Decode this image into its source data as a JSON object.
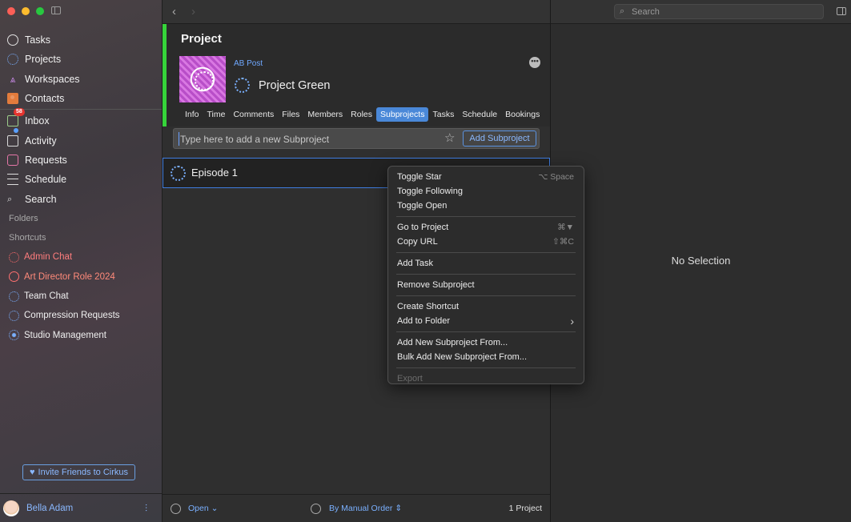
{
  "sidebar": {
    "nav": [
      {
        "label": "Tasks",
        "icon": "circle-icon"
      },
      {
        "label": "Projects",
        "icon": "dotted-circle-icon"
      },
      {
        "label": "Workspaces",
        "icon": "workspaces-icon"
      },
      {
        "label": "Contacts",
        "icon": "contacts-icon"
      }
    ],
    "nav2": [
      {
        "label": "Inbox",
        "icon": "inbox-icon",
        "badge": "58"
      },
      {
        "label": "Activity",
        "icon": "activity-icon"
      },
      {
        "label": "Requests",
        "icon": "requests-icon"
      },
      {
        "label": "Schedule",
        "icon": "schedule-icon"
      },
      {
        "label": "Search",
        "icon": "search-icon"
      }
    ],
    "folders_label": "Folders",
    "shortcuts_label": "Shortcuts",
    "shortcuts": [
      {
        "label": "Admin Chat",
        "color": "#ff7d7d"
      },
      {
        "label": "Art Director Role 2024",
        "color": "#ff8a7a"
      },
      {
        "label": "Team Chat",
        "color": "#f0f0f0"
      },
      {
        "label": "Compression Requests",
        "color": "#f0f0f0"
      },
      {
        "label": "Studio Management",
        "color": "#f0f0f0"
      }
    ],
    "invite_label": "Invite Friends to Cirkus",
    "user_name": "Bella Adam"
  },
  "project": {
    "header_title": "Project",
    "workspace": "AB Post",
    "name": "Project Green",
    "more_label": "•••",
    "tabs": [
      "Info",
      "Time",
      "Comments",
      "Files",
      "Members",
      "Roles",
      "Subprojects",
      "Tasks",
      "Schedule",
      "Bookings"
    ],
    "active_tab": "Subprojects",
    "add_placeholder": "Type here to add a new Subproject",
    "add_button": "Add Subproject",
    "subprojects": [
      {
        "name": "Episode 1"
      }
    ]
  },
  "footer": {
    "filter": "Open",
    "sort": "By Manual Order",
    "count": "1 Project"
  },
  "right": {
    "search_placeholder": "Search",
    "empty": "No Selection"
  },
  "context_menu": {
    "groups": [
      [
        {
          "label": "Toggle Star",
          "shortcut": "⌥ Space"
        },
        {
          "label": "Toggle Following",
          "shortcut": ""
        },
        {
          "label": "Toggle Open",
          "shortcut": ""
        }
      ],
      [
        {
          "label": "Go to Project",
          "shortcut": "⌘▼"
        },
        {
          "label": "Copy URL",
          "shortcut": "⇧⌘C"
        }
      ],
      [
        {
          "label": "Add Task",
          "shortcut": ""
        }
      ],
      [
        {
          "label": "Remove Subproject",
          "shortcut": ""
        }
      ],
      [
        {
          "label": "Create Shortcut",
          "shortcut": ""
        },
        {
          "label": "Add to Folder",
          "shortcut": "›"
        }
      ],
      [
        {
          "label": "Add New Subproject From...",
          "shortcut": ""
        },
        {
          "label": "Bulk Add New Subproject From...",
          "shortcut": ""
        }
      ],
      [
        {
          "label": "Export",
          "shortcut": "",
          "disabled": true
        }
      ]
    ]
  },
  "colors": {
    "accent": "#4a88d8",
    "project_status": "#36d43a",
    "link": "#7ab0ff"
  }
}
